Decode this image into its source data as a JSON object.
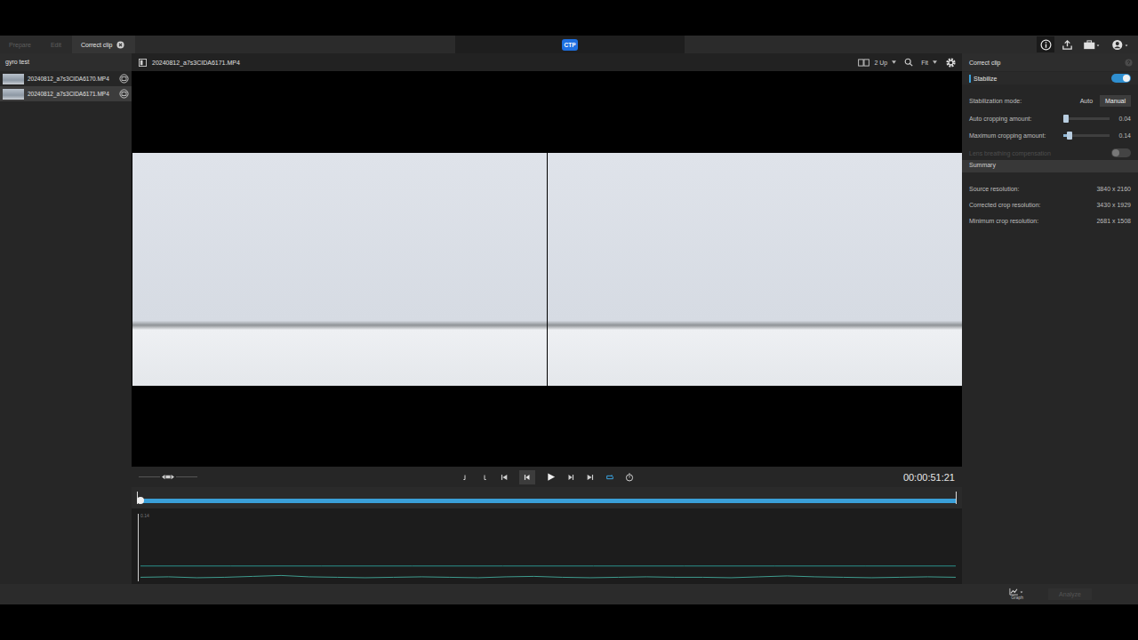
{
  "header": {
    "tabs": [
      {
        "label": "Prepare",
        "selected": false,
        "disabled": true,
        "closable": false
      },
      {
        "label": "Edit",
        "selected": false,
        "disabled": true,
        "closable": false
      },
      {
        "label": "Correct clip",
        "selected": true,
        "disabled": false,
        "closable": true
      }
    ],
    "logo": "CTP"
  },
  "library": {
    "title": "gyro test",
    "clips": [
      {
        "name": "20240812_a7s3CIDA6170.MP4",
        "selected": false
      },
      {
        "name": "20240812_a7s3CIDA6171.MP4",
        "selected": true
      }
    ]
  },
  "viewer": {
    "filename": "20240812_a7s3CIDA6171.MP4",
    "layout": "2 Up",
    "zoom": "Fit",
    "frames": 2
  },
  "transport": {
    "timecode": "00:00:51:21",
    "loop": true,
    "playhead": 0
  },
  "graph": {
    "max_label": "0.14",
    "series": [
      {
        "color": "#2a8f8a",
        "values": [
          0.034,
          0.034,
          0.034,
          0.034,
          0.034,
          0.034,
          0.034,
          0.034,
          0.034,
          0.034
        ]
      },
      {
        "color": "#3f9c8f",
        "values": [
          0.009,
          0.01,
          0.008,
          0.009,
          0.011,
          0.013,
          0.01,
          0.009,
          0.008,
          0.009,
          0.01,
          0.009,
          0.008,
          0.01,
          0.011,
          0.009,
          0.008,
          0.009,
          0.01,
          0.009,
          0.009,
          0.008,
          0.01,
          0.012,
          0.01,
          0.009,
          0.008,
          0.009,
          0.01,
          0.009
        ]
      }
    ]
  },
  "panel": {
    "title": "Correct clip",
    "stabilize": {
      "label": "Stabilize",
      "on": true
    },
    "mode": {
      "label": "Stabilization mode:",
      "options": [
        {
          "label": "Auto",
          "selected": false
        },
        {
          "label": "Manual",
          "selected": true
        }
      ]
    },
    "sliders": [
      {
        "label": "Auto cropping amount:",
        "level": 0.02,
        "reading": "0.04"
      },
      {
        "label": "Maximum cropping amount:",
        "level": 0.1,
        "reading": "0.14"
      }
    ],
    "lens": {
      "label": "Lens breathing compensation",
      "on": false,
      "disabled": true
    },
    "summary": {
      "title": "Summary",
      "rows": [
        {
          "label": "Source resolution:",
          "value": "3840 x 2160"
        },
        {
          "label": "Corrected crop resolution:",
          "value": "3430 x 1929"
        },
        {
          "label": "Minimum crop resolution:",
          "value": "2681 x 1508"
        }
      ]
    }
  },
  "footer": {
    "graph_button": "Graph",
    "analyze_button": {
      "label": "Analyze",
      "disabled": true
    }
  }
}
